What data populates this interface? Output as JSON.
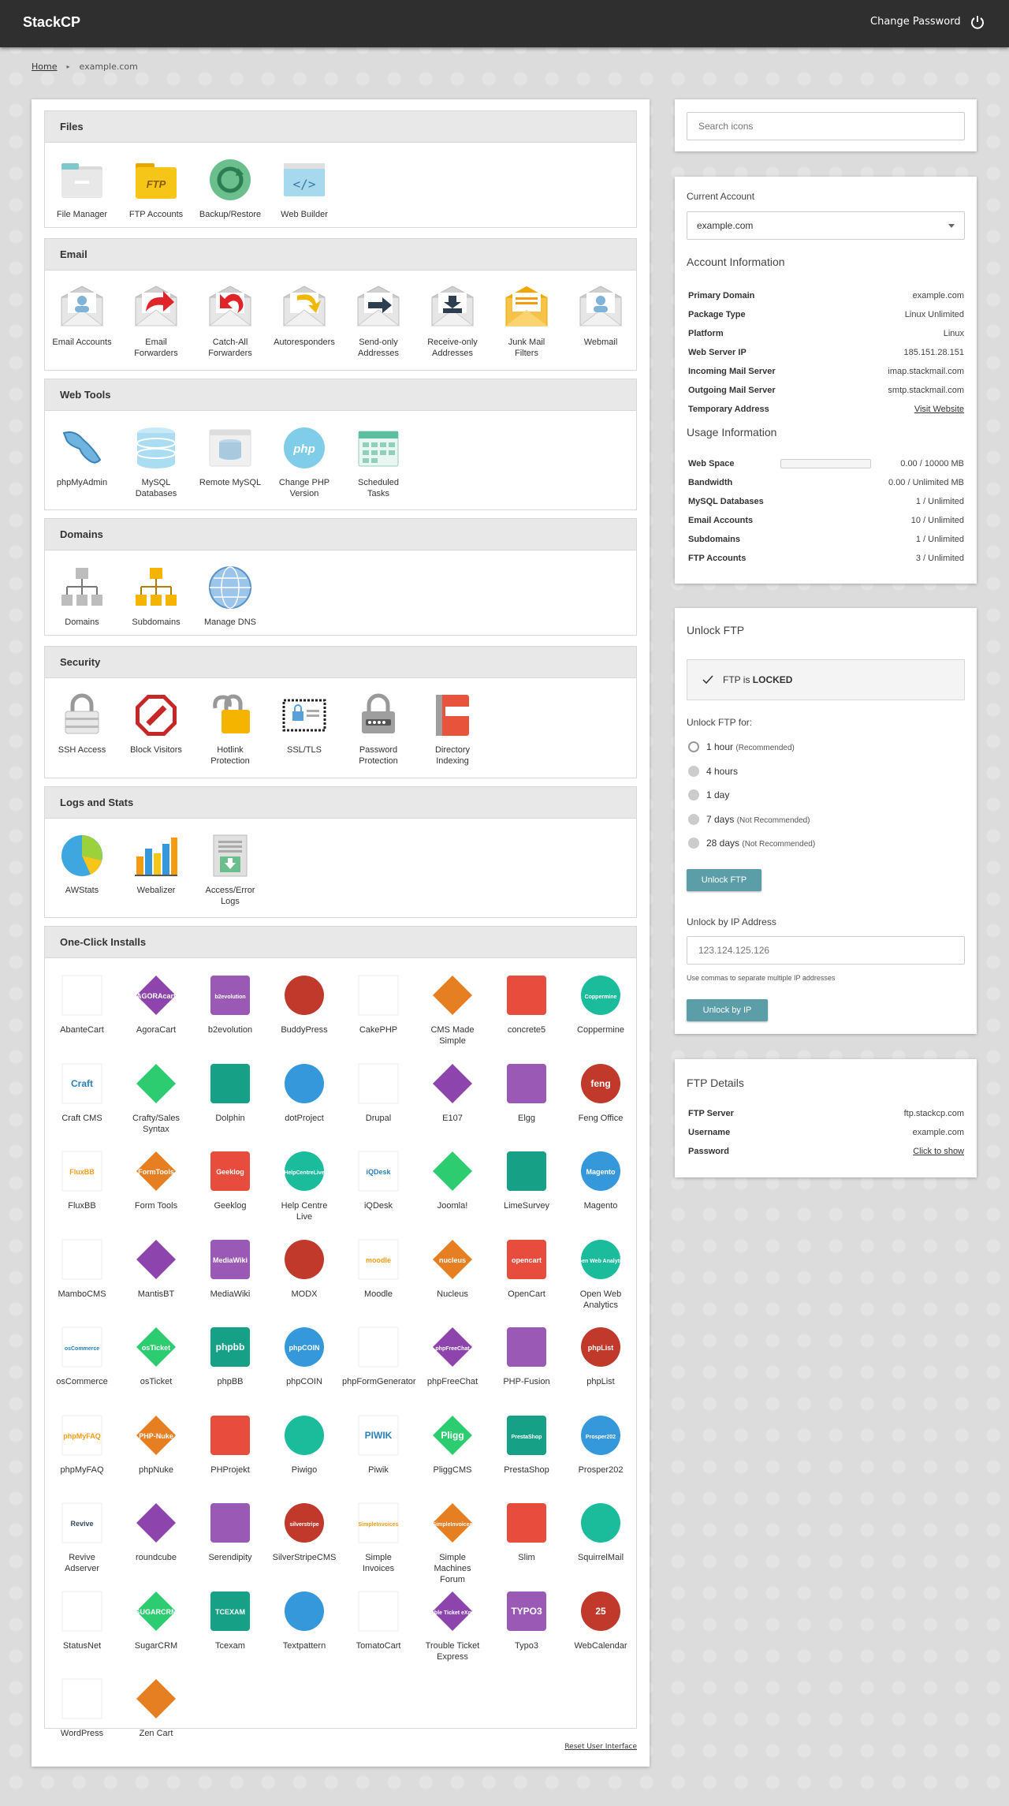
{
  "header": {
    "brand": "StackCP",
    "change_password": "Change Password",
    "power_icon": "power-icon"
  },
  "breadcrumb": {
    "home": "Home",
    "current": "example.com"
  },
  "sections": [
    {
      "title": "Files",
      "items": [
        {
          "label": [
            "File Manager"
          ],
          "icon": "file-manager-icon"
        },
        {
          "label": [
            "FTP Accounts"
          ],
          "icon": "ftp-icon"
        },
        {
          "label": [
            "Backup/Restore"
          ],
          "icon": "backup-icon"
        },
        {
          "label": [
            "Web Builder"
          ],
          "icon": "web-builder-icon"
        }
      ]
    },
    {
      "title": "Email",
      "items": [
        {
          "label": [
            "Email Accounts"
          ],
          "icon": "email-accounts-icon"
        },
        {
          "label": [
            "Email",
            "Forwarders"
          ],
          "icon": "email-forwarders-icon"
        },
        {
          "label": [
            "Catch-All",
            "Forwarders"
          ],
          "icon": "catch-all-icon"
        },
        {
          "label": [
            "Autoresponders"
          ],
          "icon": "autoresponder-icon"
        },
        {
          "label": [
            "Send-only",
            "Addresses"
          ],
          "icon": "send-only-icon"
        },
        {
          "label": [
            "Receive-only",
            "Addresses"
          ],
          "icon": "receive-only-icon"
        },
        {
          "label": [
            "Junk Mail",
            "Filters"
          ],
          "icon": "junk-mail-icon"
        },
        {
          "label": [
            "Webmail"
          ],
          "icon": "webmail-icon"
        }
      ]
    },
    {
      "title": "Web Tools",
      "items": [
        {
          "label": [
            "phpMyAdmin"
          ],
          "icon": "phpmyadmin-icon"
        },
        {
          "label": [
            "MySQL",
            "Databases"
          ],
          "icon": "mysql-icon"
        },
        {
          "label": [
            "Remote MySQL"
          ],
          "icon": "remote-mysql-icon"
        },
        {
          "label": [
            "Change PHP",
            "Version"
          ],
          "icon": "php-icon"
        },
        {
          "label": [
            "Scheduled",
            "Tasks"
          ],
          "icon": "calendar-icon"
        }
      ]
    },
    {
      "title": "Domains",
      "items": [
        {
          "label": [
            "Domains"
          ],
          "icon": "domains-icon"
        },
        {
          "label": [
            "Subdomains"
          ],
          "icon": "subdomains-icon"
        },
        {
          "label": [
            "Manage DNS"
          ],
          "icon": "globe-icon"
        }
      ]
    },
    {
      "title": "Security",
      "items": [
        {
          "label": [
            "SSH Access"
          ],
          "icon": "ssh-lock-icon"
        },
        {
          "label": [
            "Block Visitors"
          ],
          "icon": "block-icon"
        },
        {
          "label": [
            "Hotlink",
            "Protection"
          ],
          "icon": "hotlink-icon"
        },
        {
          "label": [
            "SSL/TLS"
          ],
          "icon": "ssl-icon"
        },
        {
          "label": [
            "Password",
            "Protection"
          ],
          "icon": "password-lock-icon"
        },
        {
          "label": [
            "Directory",
            "Indexing"
          ],
          "icon": "directory-icon"
        }
      ]
    },
    {
      "title": "Logs and Stats",
      "items": [
        {
          "label": [
            "AWStats"
          ],
          "icon": "pie-chart-icon"
        },
        {
          "label": [
            "Webalizer"
          ],
          "icon": "bar-chart-icon"
        },
        {
          "label": [
            "Access/Error",
            "Logs"
          ],
          "icon": "logs-icon"
        }
      ]
    },
    {
      "title": "One-Click Installs",
      "items": [
        {
          "label": [
            "AbanteCart"
          ]
        },
        {
          "label": [
            "AgoraCart"
          ]
        },
        {
          "label": [
            "b2evolution"
          ]
        },
        {
          "label": [
            "BuddyPress"
          ]
        },
        {
          "label": [
            "CakePHP"
          ]
        },
        {
          "label": [
            "CMS Made",
            "Simple"
          ]
        },
        {
          "label": [
            "concrete5"
          ]
        },
        {
          "label": [
            "Coppermine"
          ]
        },
        {
          "label": [
            "Craft CMS"
          ]
        },
        {
          "label": [
            "Crafty/Sales",
            "Syntax"
          ]
        },
        {
          "label": [
            "Dolphin"
          ]
        },
        {
          "label": [
            "dotProject"
          ]
        },
        {
          "label": [
            "Drupal"
          ]
        },
        {
          "label": [
            "E107"
          ]
        },
        {
          "label": [
            "Elgg"
          ]
        },
        {
          "label": [
            "Feng Office"
          ]
        },
        {
          "label": [
            "FluxBB"
          ]
        },
        {
          "label": [
            "Form Tools"
          ]
        },
        {
          "label": [
            "Geeklog"
          ]
        },
        {
          "label": [
            "Help Centre",
            "Live"
          ]
        },
        {
          "label": [
            "iQDesk"
          ]
        },
        {
          "label": [
            "Joomla!"
          ]
        },
        {
          "label": [
            "LimeSurvey"
          ]
        },
        {
          "label": [
            "Magento"
          ]
        },
        {
          "label": [
            "MamboCMS"
          ]
        },
        {
          "label": [
            "MantisBT"
          ]
        },
        {
          "label": [
            "MediaWiki"
          ]
        },
        {
          "label": [
            "MODX"
          ]
        },
        {
          "label": [
            "Moodle"
          ]
        },
        {
          "label": [
            "Nucleus"
          ]
        },
        {
          "label": [
            "OpenCart"
          ]
        },
        {
          "label": [
            "Open Web",
            "Analytics"
          ]
        },
        {
          "label": [
            "osCommerce"
          ]
        },
        {
          "label": [
            "osTicket"
          ]
        },
        {
          "label": [
            "phpBB"
          ]
        },
        {
          "label": [
            "phpCOIN"
          ]
        },
        {
          "label": [
            "phpFormGenerator"
          ]
        },
        {
          "label": [
            "phpFreeChat"
          ]
        },
        {
          "label": [
            "PHP-Fusion"
          ]
        },
        {
          "label": [
            "phpList"
          ]
        },
        {
          "label": [
            "phpMyFAQ"
          ]
        },
        {
          "label": [
            "phpNuke"
          ]
        },
        {
          "label": [
            "PHProjekt"
          ]
        },
        {
          "label": [
            "Piwigo"
          ]
        },
        {
          "label": [
            "Piwik"
          ]
        },
        {
          "label": [
            "PliggCMS"
          ]
        },
        {
          "label": [
            "PrestaShop"
          ]
        },
        {
          "label": [
            "Prosper202"
          ]
        },
        {
          "label": [
            "Revive",
            "Adserver"
          ]
        },
        {
          "label": [
            "roundcube"
          ]
        },
        {
          "label": [
            "Serendipity"
          ]
        },
        {
          "label": [
            "SilverStripeCMS"
          ]
        },
        {
          "label": [
            "Simple",
            "Invoices"
          ]
        },
        {
          "label": [
            "Simple",
            "Machines",
            "Forum"
          ]
        },
        {
          "label": [
            "Slim"
          ]
        },
        {
          "label": [
            "SquirrelMail"
          ]
        },
        {
          "label": [
            "StatusNet"
          ]
        },
        {
          "label": [
            "SugarCRM"
          ]
        },
        {
          "label": [
            "Tcexam"
          ]
        },
        {
          "label": [
            "Textpattern"
          ]
        },
        {
          "label": [
            "TomatoCart"
          ]
        },
        {
          "label": [
            "Trouble Ticket",
            "Express"
          ]
        },
        {
          "label": [
            "Typo3"
          ]
        },
        {
          "label": [
            "WebCalendar"
          ]
        },
        {
          "label": [
            "WordPress"
          ]
        },
        {
          "label": [
            "Zen Cart"
          ]
        }
      ]
    }
  ],
  "logo_texts": {
    "AgoraCart": "AGORAcart",
    "b2evolution": "b2evolution",
    "Coppermine": "Coppermine",
    "Craft CMS": "Craft",
    "Feng Office": "feng",
    "FluxBB": "FluxBB",
    "Geeklog": "Geeklog",
    "iQDesk": "iQDesk",
    "Magento": "Magento",
    "MediaWiki": "MediaWiki",
    "Moodle": "moodle",
    "Nucleus": "nucleus",
    "OpenCart": "opencart",
    "osCommerce": "osCommerce",
    "osTicket": "osTicket",
    "phpBB": "phpbb",
    "phpCOIN": "phpCOIN",
    "phpList": "phpList",
    "phpMyFAQ": "phpMyFAQ",
    "phpNuke": "PHP-Nuke",
    "Piwik": "PIWIK",
    "PliggCMS": "Pligg",
    "PrestaShop": "PrestaShop",
    "Prosper202": "Prosper202",
    "Revive": "Revive",
    "SilverStripeCMS": "silverstripe",
    "SugarCRM": "SUGARCRM",
    "Tcexam": "TCEXAM",
    "Trouble Ticket": "Trouble Ticket eXpress",
    "Typo3": "TYPO3",
    "WebCalendar": "25",
    "FTP Accounts": "FTP",
    "Form Tools": "FormTools",
    "Help Centre": "HelpCentreLive",
    "phpFreeChat": "phpFreeChat",
    "Open Web": "Open Web Analytics",
    "Simple": "SimpleInvoices"
  },
  "reset_link": "Reset User Interface",
  "search": {
    "placeholder": "Search icons"
  },
  "account": {
    "current_label": "Current Account",
    "current_value": "example.com",
    "info_title": "Account Information",
    "rows": [
      {
        "k": "Primary Domain",
        "v": "example.com"
      },
      {
        "k": "Package Type",
        "v": "Linux Unlimited"
      },
      {
        "k": "Platform",
        "v": "Linux"
      },
      {
        "k": "Web Server IP",
        "v": "185.151.28.151"
      },
      {
        "k": "Incoming Mail Server",
        "v": "imap.stackmail.com"
      },
      {
        "k": "Outgoing Mail Server",
        "v": "smtp.stackmail.com"
      },
      {
        "k": "Temporary Address",
        "v": "Visit Website"
      }
    ],
    "usage_title": "Usage Information",
    "usage": [
      {
        "k": "Web Space",
        "v": "0.00 / 10000 MB"
      },
      {
        "k": "Bandwidth",
        "v": "0.00 / Unlimited MB"
      },
      {
        "k": "MySQL Databases",
        "v": "1 / Unlimited"
      },
      {
        "k": "Email Accounts",
        "v": "10 / Unlimited"
      },
      {
        "k": "Subdomains",
        "v": "1 / Unlimited"
      },
      {
        "k": "FTP Accounts",
        "v": "3 / Unlimited"
      }
    ]
  },
  "unlock_ftp": {
    "title": "Unlock FTP",
    "status_prefix": "FTP is",
    "status_value": "LOCKED",
    "for_label": "Unlock FTP for:",
    "options": [
      {
        "label": "1 hour",
        "note": "(Recommended)",
        "selected": true
      },
      {
        "label": "4 hours",
        "note": "",
        "selected": false
      },
      {
        "label": "1 day",
        "note": "",
        "selected": false
      },
      {
        "label": "7 days",
        "note": "(Not Recommended)",
        "selected": false
      },
      {
        "label": "28 days",
        "note": "(Not Recommended)",
        "selected": false
      }
    ],
    "unlock_button": "Unlock FTP",
    "ip_label": "Unlock by IP Address",
    "ip_placeholder": "123.124.125.126",
    "ip_hint": "Use commas to separate multiple IP addresses",
    "ip_button": "Unlock by IP"
  },
  "ftp_details": {
    "title": "FTP Details",
    "rows": [
      {
        "k": "FTP Server",
        "v": "ftp.stackcp.com"
      },
      {
        "k": "Username",
        "v": "example.com"
      },
      {
        "k": "Password",
        "v": "Click to show"
      }
    ]
  },
  "colors": {
    "topbar": "#2f2f2f",
    "accent_button": "#5b9ea8",
    "section_header": "#e8e8e8"
  }
}
